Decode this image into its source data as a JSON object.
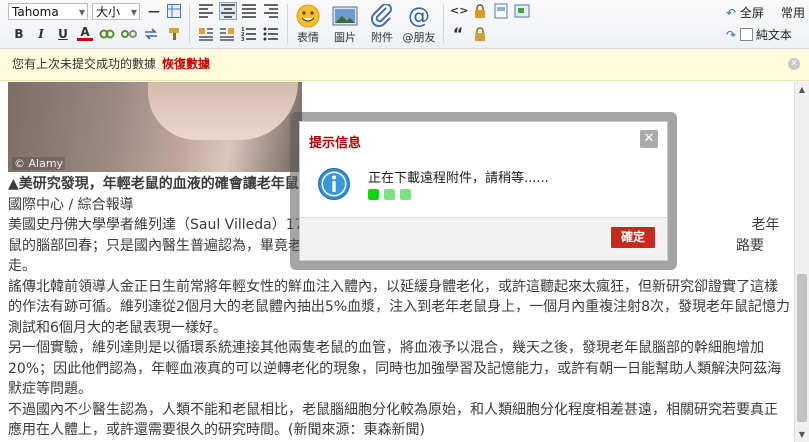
{
  "toolbar": {
    "font_family": "Tahoma",
    "font_size": "大小",
    "big_buttons": [
      {
        "label": "表情",
        "icon": "smiley-icon"
      },
      {
        "label": "圖片",
        "icon": "image-icon"
      },
      {
        "label": "附件",
        "icon": "paperclip-icon"
      },
      {
        "label": "@朋友",
        "icon": "at-icon"
      }
    ],
    "fullscreen_label": "全屏",
    "common_label": "常用",
    "plain_text_label": "純文本"
  },
  "notice": {
    "message": "您有上次未提交成功的數據",
    "restore_label": "恢復數據"
  },
  "article": {
    "watermark": "© Alamy",
    "headline": "▲美研究發現，年輕老鼠的血液的確會讓老年鼠",
    "byline": "國際中心 / 綜合報導",
    "paragraphs": [
      "美國史丹佛大學學者維列達（Saul Villeda）17日　　　　　　　　　　　　　　　　　　　　　　　　　　　　　　　老年鼠的腦部回春；只是國內醫生普遍認為，畢竟老鼠和人類的腦細　　　　　　　　　　　　　　　　　　　　　　　　路要走。",
      "謠傳北韓前領導人金正日生前常將年輕女性的鮮血注入體內，以延緩身體老化，或許這聽起來太瘋狂，但新研究卻證實了這樣的作法有跡可循。維列達從2個月大的老鼠體內抽出5%血漿，注入到老年老鼠身上，一個月內重複注射8次，發現老年鼠記憶力測試和6個月大的老鼠表現一樣好。",
      "另一個實驗，維列達則是以循環系統連接其他兩隻老鼠的血管，將血液予以混合，幾天之後，發現老年鼠腦部的幹細胞增加20%；因此他們認為，年輕血液真的可以逆轉老化的現象，同時也加強學習及記憶能力，或許有朝一日能幫助人類解決阿茲海默症等問題。",
      "不過國內不少醫生認為，人類不能和老鼠相比，老鼠腦細胞分化較為原始，和人類細胞分化程度相差甚遠，相關研究若要真正應用在人體上，或許還需要很久的研究時間。(新聞來源：東森新聞)"
    ]
  },
  "dialog": {
    "title": "提示信息",
    "close_glyph": "✕",
    "message": "正在下載遠程附件，請稍等......",
    "ok_label": "確定",
    "dot_colors": [
      "#12d312",
      "#7fe07f",
      "#7fe07f"
    ]
  },
  "colors": {
    "title_red": "#b30000",
    "ok_red": "#c8291f",
    "info_blue": "#2f8fd6"
  }
}
